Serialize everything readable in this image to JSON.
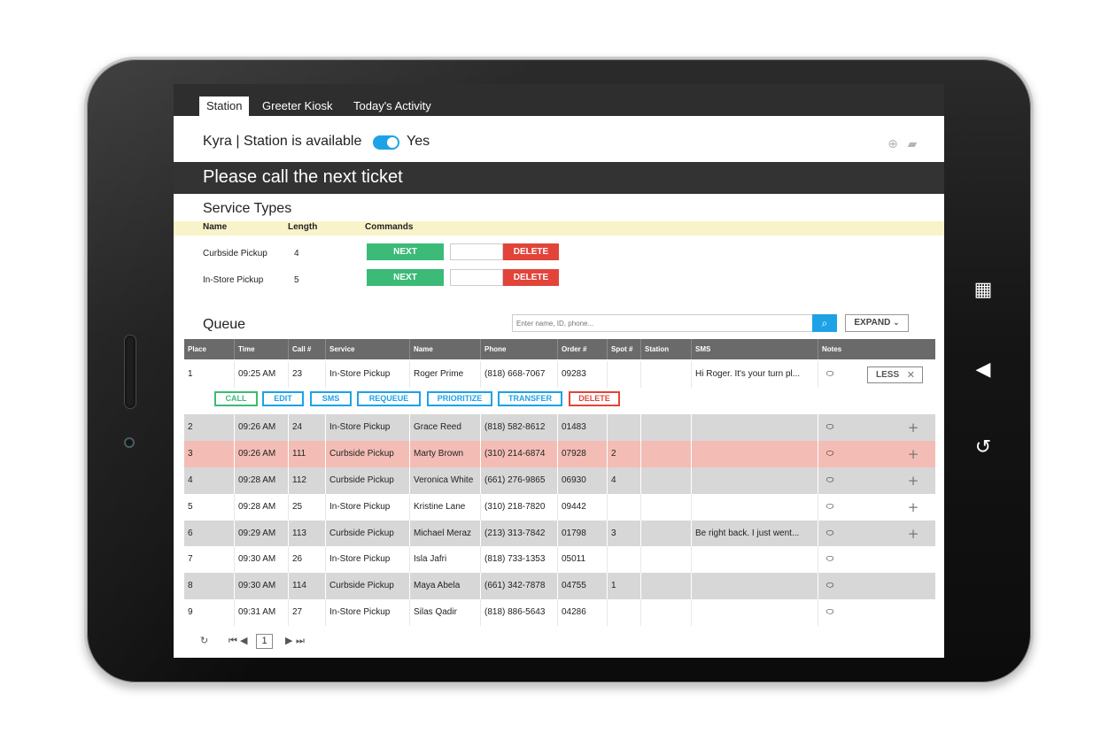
{
  "tabs": [
    "Station",
    "Greeter Kiosk",
    "Today's Activity"
  ],
  "status": {
    "text": "Kyra | Station is available",
    "toggle_label": "Yes",
    "toggle_on": true
  },
  "call_banner": "Please call the next ticket",
  "service_types": {
    "title": "Service Types",
    "headers": {
      "name": "Name",
      "length": "Length",
      "commands": "Commands"
    },
    "rows": [
      {
        "name": "Curbside Pickup",
        "length": "4",
        "next": "NEXT",
        "delete": "DELETE"
      },
      {
        "name": "In-Store Pickup",
        "length": "5",
        "next": "NEXT",
        "delete": "DELETE"
      }
    ]
  },
  "queue": {
    "title": "Queue",
    "search_placeholder": "Enter name, ID, phone...",
    "expand_label": "EXPAND",
    "columns": [
      "Place",
      "Time",
      "Call #",
      "Service",
      "Name",
      "Phone",
      "Order #",
      "Spot #",
      "Station",
      "SMS",
      "Notes"
    ],
    "less_label": "LESS",
    "actions": [
      "CALL",
      "EDIT",
      "SMS",
      "REQUEUE",
      "PRIORITIZE",
      "TRANSFER",
      "DELETE"
    ],
    "rows": [
      {
        "place": "1",
        "time": "09:25 AM",
        "call": "23",
        "service": "In-Store Pickup",
        "name": "Roger Prime",
        "phone": "(818) 668-7067",
        "order": "09283",
        "spot": "",
        "station": "",
        "sms": "Hi Roger. It's your turn pl..."
      },
      {
        "place": "2",
        "time": "09:26 AM",
        "call": "24",
        "service": "In-Store Pickup",
        "name": "Grace Reed",
        "phone": "(818) 582-8612",
        "order": "01483",
        "spot": "",
        "station": "",
        "sms": ""
      },
      {
        "place": "3",
        "time": "09:26 AM",
        "call": "111",
        "service": "Curbside Pickup",
        "name": "Marty Brown",
        "phone": "(310) 214-6874",
        "order": "07928",
        "spot": "2",
        "station": "",
        "sms": ""
      },
      {
        "place": "4",
        "time": "09:28 AM",
        "call": "112",
        "service": "Curbside Pickup",
        "name": "Veronica White",
        "phone": "(661) 276-9865",
        "order": "06930",
        "spot": "4",
        "station": "",
        "sms": ""
      },
      {
        "place": "5",
        "time": "09:28 AM",
        "call": "25",
        "service": "In-Store Pickup",
        "name": "Kristine Lane",
        "phone": "(310) 218-7820",
        "order": "09442",
        "spot": "",
        "station": "",
        "sms": ""
      },
      {
        "place": "6",
        "time": "09:29 AM",
        "call": "113",
        "service": "Curbside Pickup",
        "name": "Michael Meraz",
        "phone": "(213) 313-7842",
        "order": "01798",
        "spot": "3",
        "station": "",
        "sms": "Be right back. I just went..."
      },
      {
        "place": "7",
        "time": "09:30 AM",
        "call": "26",
        "service": "In-Store Pickup",
        "name": "Isla Jafri",
        "phone": "(818) 733-1353",
        "order": "05011",
        "spot": "",
        "station": "",
        "sms": ""
      },
      {
        "place": "8",
        "time": "09:30 AM",
        "call": "114",
        "service": "Curbside Pickup",
        "name": "Maya Abela",
        "phone": "(661) 342-7878",
        "order": "04755",
        "spot": "1",
        "station": "",
        "sms": ""
      },
      {
        "place": "9",
        "time": "09:31 AM",
        "call": "27",
        "service": "In-Store Pickup",
        "name": "Silas Qadir",
        "phone": "(818) 886-5643",
        "order": "04286",
        "spot": "",
        "station": "",
        "sms": ""
      }
    ]
  },
  "pager": {
    "page": "1"
  },
  "icons": {
    "globe": "globe-icon",
    "chat": "chat-bubble-icon",
    "search": "search-icon",
    "chevron": "chevron-down-icon",
    "note": "note-bubble-icon",
    "plus": "plus-icon",
    "close": "close-icon",
    "refresh": "refresh-icon",
    "first": "first-page-icon",
    "prev": "prev-page-icon",
    "next": "next-page-icon",
    "last": "last-page-icon",
    "menu": "menu-grid-icon",
    "back": "back-icon",
    "rotate": "rotate-icon"
  },
  "colors": {
    "accent": "#1ea2e6",
    "next_green": "#3cba77",
    "delete_red": "#e2443a",
    "highlight_row": "#f3bdb6",
    "header_yellow": "#f8f3c9",
    "dark_bar": "#333333"
  }
}
